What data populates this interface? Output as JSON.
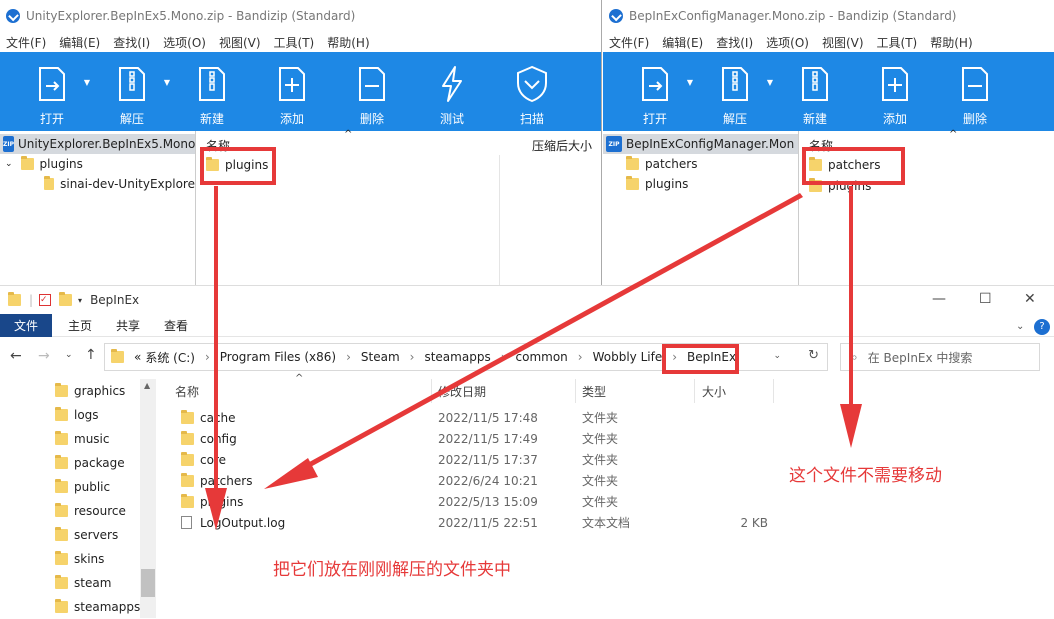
{
  "bandizip_left": {
    "title": "UnityExplorer.BepInEx5.Mono.zip - Bandizip (Standard)",
    "menu": [
      "文件(F)",
      "编辑(E)",
      "查找(I)",
      "选项(O)",
      "视图(V)",
      "工具(T)",
      "帮助(H)"
    ],
    "toolbar": [
      "打开",
      "解压",
      "新建",
      "添加",
      "删除",
      "测试",
      "扫描"
    ],
    "tree": {
      "root": "UnityExplorer.BepInEx5.Mono",
      "child": "plugins",
      "grandchild": "sinai-dev-UnityExplore"
    },
    "list_headers": {
      "name": "名称",
      "size": "压缩后大小"
    },
    "items": [
      "plugins"
    ]
  },
  "bandizip_right": {
    "title": "BepInExConfigManager.Mono.zip - Bandizip (Standard)",
    "menu": [
      "文件(F)",
      "编辑(E)",
      "查找(I)",
      "选项(O)",
      "视图(V)",
      "工具(T)",
      "帮助(H)"
    ],
    "toolbar": [
      "打开",
      "解压",
      "新建",
      "添加",
      "删除"
    ],
    "tree": {
      "root": "BepInExConfigManager.Mon",
      "children": [
        "patchers",
        "plugins"
      ]
    },
    "list_headers": {
      "name": "名称"
    },
    "items": [
      "patchers",
      "plugins"
    ]
  },
  "explorer": {
    "title": "BepInEx",
    "ribbon": [
      "文件",
      "主页",
      "共享",
      "查看"
    ],
    "breadcrumb": [
      "«",
      "系统 (C:)",
      "Program Files (x86)",
      "Steam",
      "steamapps",
      "common",
      "Wobbly Life",
      "BepInEx"
    ],
    "search_placeholder": "在 BepInEx 中搜索",
    "nav": [
      "graphics",
      "logs",
      "music",
      "package",
      "public",
      "resource",
      "servers",
      "skins",
      "steam",
      "steamapps"
    ],
    "columns": {
      "name": "名称",
      "date": "修改日期",
      "type": "类型",
      "size": "大小"
    },
    "files": [
      {
        "name": "cache",
        "date": "2022/11/5 17:48",
        "type": "文件夹",
        "size": ""
      },
      {
        "name": "config",
        "date": "2022/11/5 17:49",
        "type": "文件夹",
        "size": ""
      },
      {
        "name": "core",
        "date": "2022/11/5 17:37",
        "type": "文件夹",
        "size": ""
      },
      {
        "name": "patchers",
        "date": "2022/6/24 10:21",
        "type": "文件夹",
        "size": ""
      },
      {
        "name": "plugins",
        "date": "2022/5/13 15:09",
        "type": "文件夹",
        "size": ""
      },
      {
        "name": "LogOutput.log",
        "date": "2022/11/5 22:51",
        "type": "文本文档",
        "size": "2 KB"
      }
    ]
  },
  "annotations": {
    "no_move": "这个文件不需要移动",
    "put_here": "把它们放在刚刚解压的文件夹中"
  },
  "colors": {
    "toolbar_blue": "#1e88e5",
    "annot_red": "#e63939",
    "folder": "#f6d36b",
    "ribbon_file": "#19478a"
  }
}
